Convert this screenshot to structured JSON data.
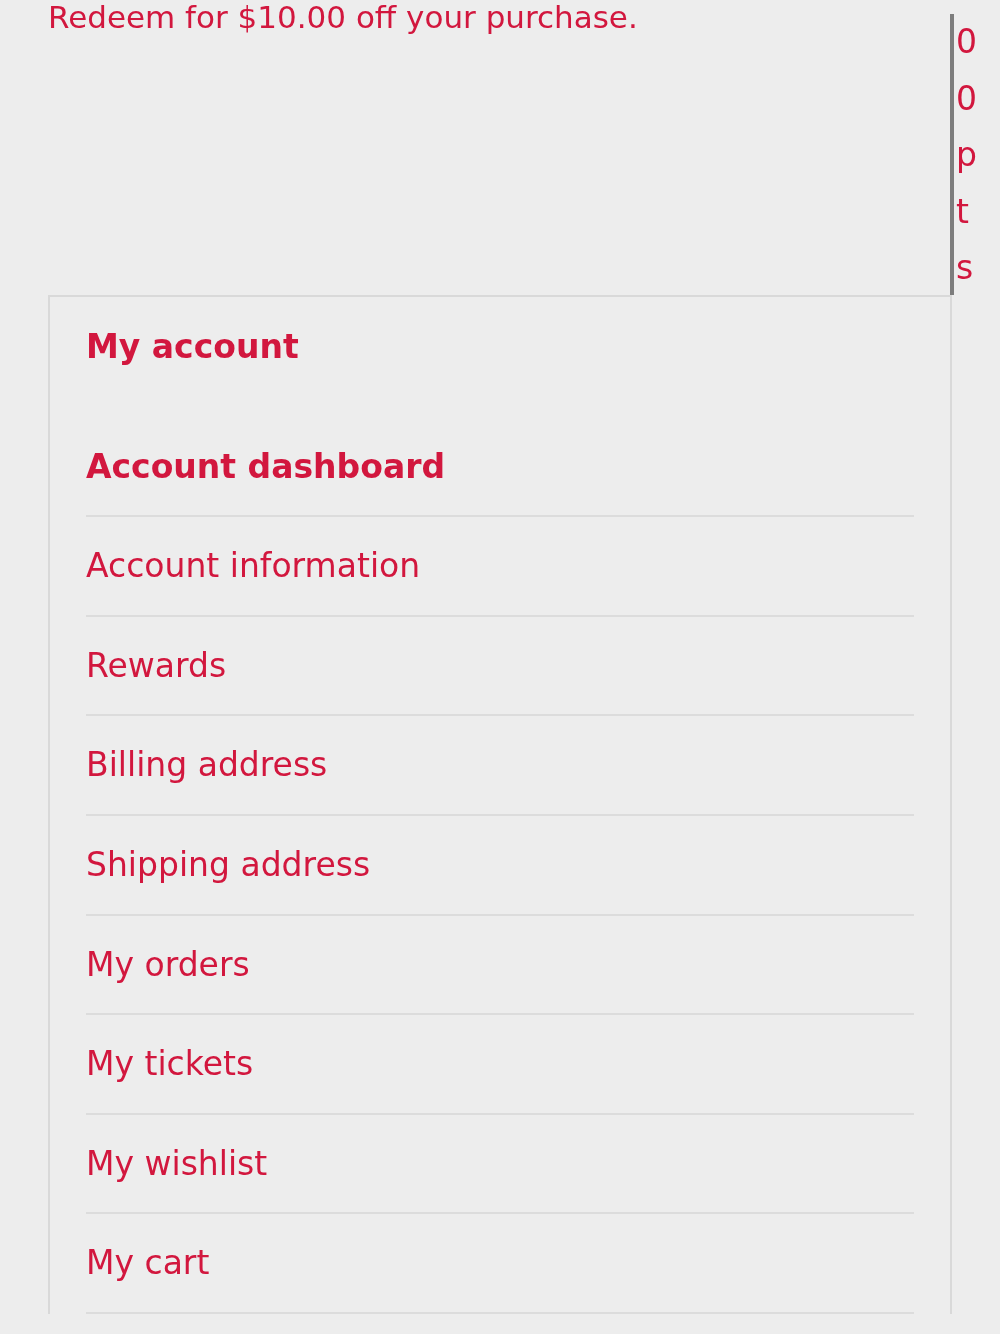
{
  "offer": {
    "text": "Redeem for $10.00 off your purchase.",
    "points": "00pts"
  },
  "account_menu": {
    "title": "My account",
    "items": [
      {
        "label": "Account dashboard",
        "selected": true
      },
      {
        "label": "Account information",
        "selected": false
      },
      {
        "label": "Rewards",
        "selected": false
      },
      {
        "label": "Billing address",
        "selected": false
      },
      {
        "label": "Shipping address",
        "selected": false
      },
      {
        "label": "My orders",
        "selected": false
      },
      {
        "label": "My tickets",
        "selected": false
      },
      {
        "label": "My wishlist",
        "selected": false
      },
      {
        "label": "My cart",
        "selected": false
      }
    ]
  }
}
